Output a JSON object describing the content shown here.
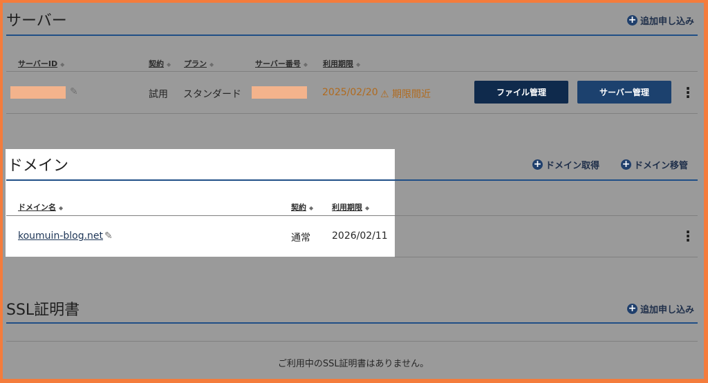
{
  "server": {
    "title": "サーバー",
    "add_label": "追加申し込み",
    "columns": {
      "server_id": "サーバーID",
      "contract": "契約",
      "plan": "プラン",
      "server_number": "サーバー番号",
      "expiry": "利用期限"
    },
    "row": {
      "contract": "試用",
      "plan": "スタンダード",
      "expiry": "2025/02/20",
      "warning": "期限間近",
      "file_button": "ファイル管理",
      "server_button": "サーバー管理"
    }
  },
  "domain": {
    "title": "ドメイン",
    "acquire_label": "ドメイン取得",
    "transfer_label": "ドメイン移管",
    "columns": {
      "name": "ドメイン名",
      "contract": "契約",
      "expiry": "利用期限"
    },
    "row": {
      "name": "koumuin-blog.net",
      "contract": "通常",
      "expiry": "2026/02/11"
    }
  },
  "ssl": {
    "title": "SSL証明書",
    "add_label": "追加申し込み",
    "empty_message": "ご利用中のSSL証明書はありません。"
  },
  "colors": {
    "border": "#f47c3c",
    "overlay": "#9a9a9a",
    "accent_blue": "#1f4e86",
    "warning": "#b06a1e",
    "redaction": "#f3b38c"
  }
}
